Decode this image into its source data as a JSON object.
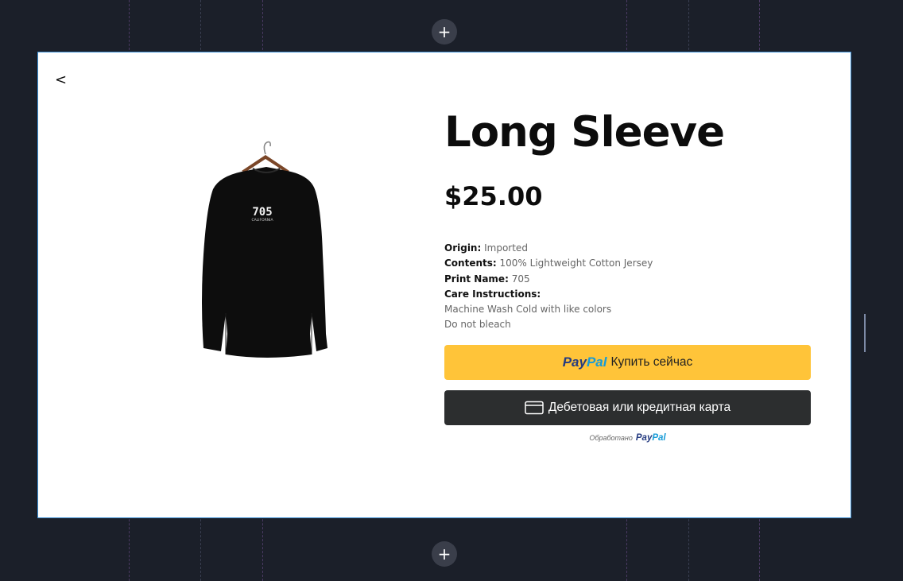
{
  "editor": {
    "add_section_label": "+",
    "back_label": "<"
  },
  "product": {
    "title": "Long Sleeve",
    "price": "$25.00",
    "image": {
      "shirt_print": "705",
      "shirt_print_sub": "CALIFORNIA"
    },
    "details": {
      "origin_label": "Origin:",
      "origin_value": "Imported",
      "contents_label": "Contents:",
      "contents_value": "100% Lightweight Cotton Jersey",
      "print_label": "Print Name:",
      "print_value": "705",
      "care_label": "Care Instructions:",
      "care_lines": [
        "Machine Wash Cold with like colors",
        "Do not bleach"
      ]
    }
  },
  "paypal": {
    "logo_part1": "Pay",
    "logo_part2": "Pal",
    "buy_now_label": "Купить сейчас",
    "card_button_label": "Дебетовая или кредитная карта",
    "powered_by_label": "Обработано",
    "colors": {
      "buy_button": "#ffc439",
      "card_button": "#2c2e2f",
      "logo_dark": "#253b80",
      "logo_light": "#179bd7"
    }
  },
  "icons": {
    "back": "chevron-left-icon",
    "add": "plus-icon",
    "card": "credit-card-icon"
  }
}
